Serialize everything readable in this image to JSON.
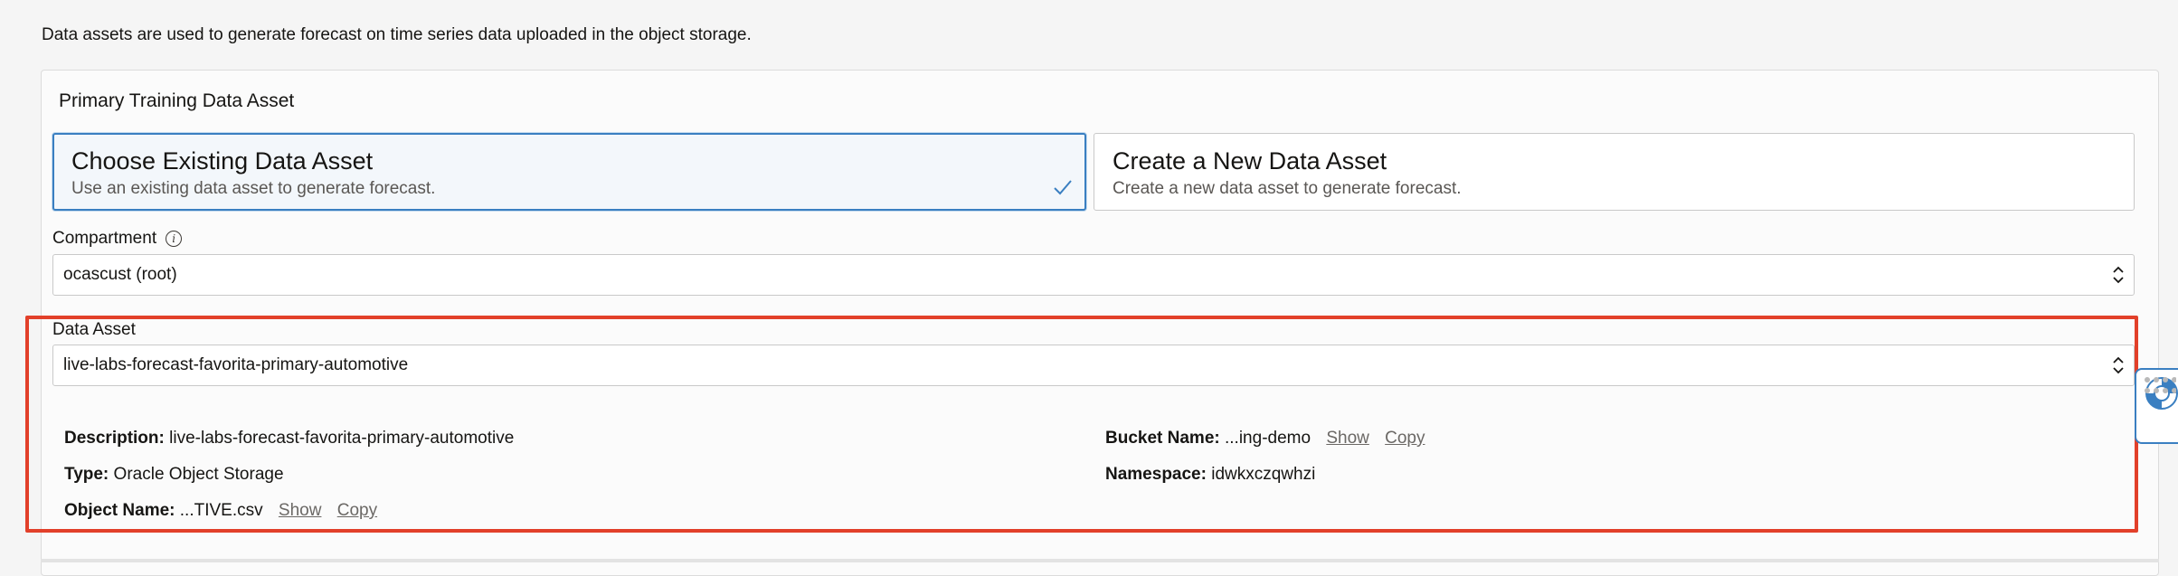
{
  "intro_text": "Data assets are used to generate forecast on time series data uploaded in the object storage.",
  "panel": {
    "title": "Primary Training Data Asset"
  },
  "cards": [
    {
      "title": "Choose Existing Data Asset",
      "description": "Use an existing data asset to generate forecast.",
      "selected": true
    },
    {
      "title": "Create a New Data Asset",
      "description": "Create a new data asset to generate forecast.",
      "selected": false
    }
  ],
  "compartment": {
    "label": "Compartment",
    "value": "ocascust (root)"
  },
  "data_asset": {
    "label": "Data Asset",
    "value": "live-labs-forecast-favorita-primary-automotive"
  },
  "details": {
    "description_label": "Description:",
    "description_value": "live-labs-forecast-favorita-primary-automotive",
    "type_label": "Type:",
    "type_value": "Oracle Object Storage",
    "object_name_label": "Object Name:",
    "object_name_value": "...TIVE.csv",
    "bucket_name_label": "Bucket Name:",
    "bucket_name_value": "...ing-demo",
    "namespace_label": "Namespace:",
    "namespace_value": "idwkxczqwhzi",
    "show_label": "Show",
    "copy_label": "Copy"
  },
  "colors": {
    "accent": "#3a7fc1",
    "highlight": "#e2402a",
    "link": "#6b6865"
  },
  "icons": [
    "checkmark-icon",
    "info-icon",
    "select-arrows-icon",
    "lifebuoy-icon",
    "grip-icon"
  ]
}
